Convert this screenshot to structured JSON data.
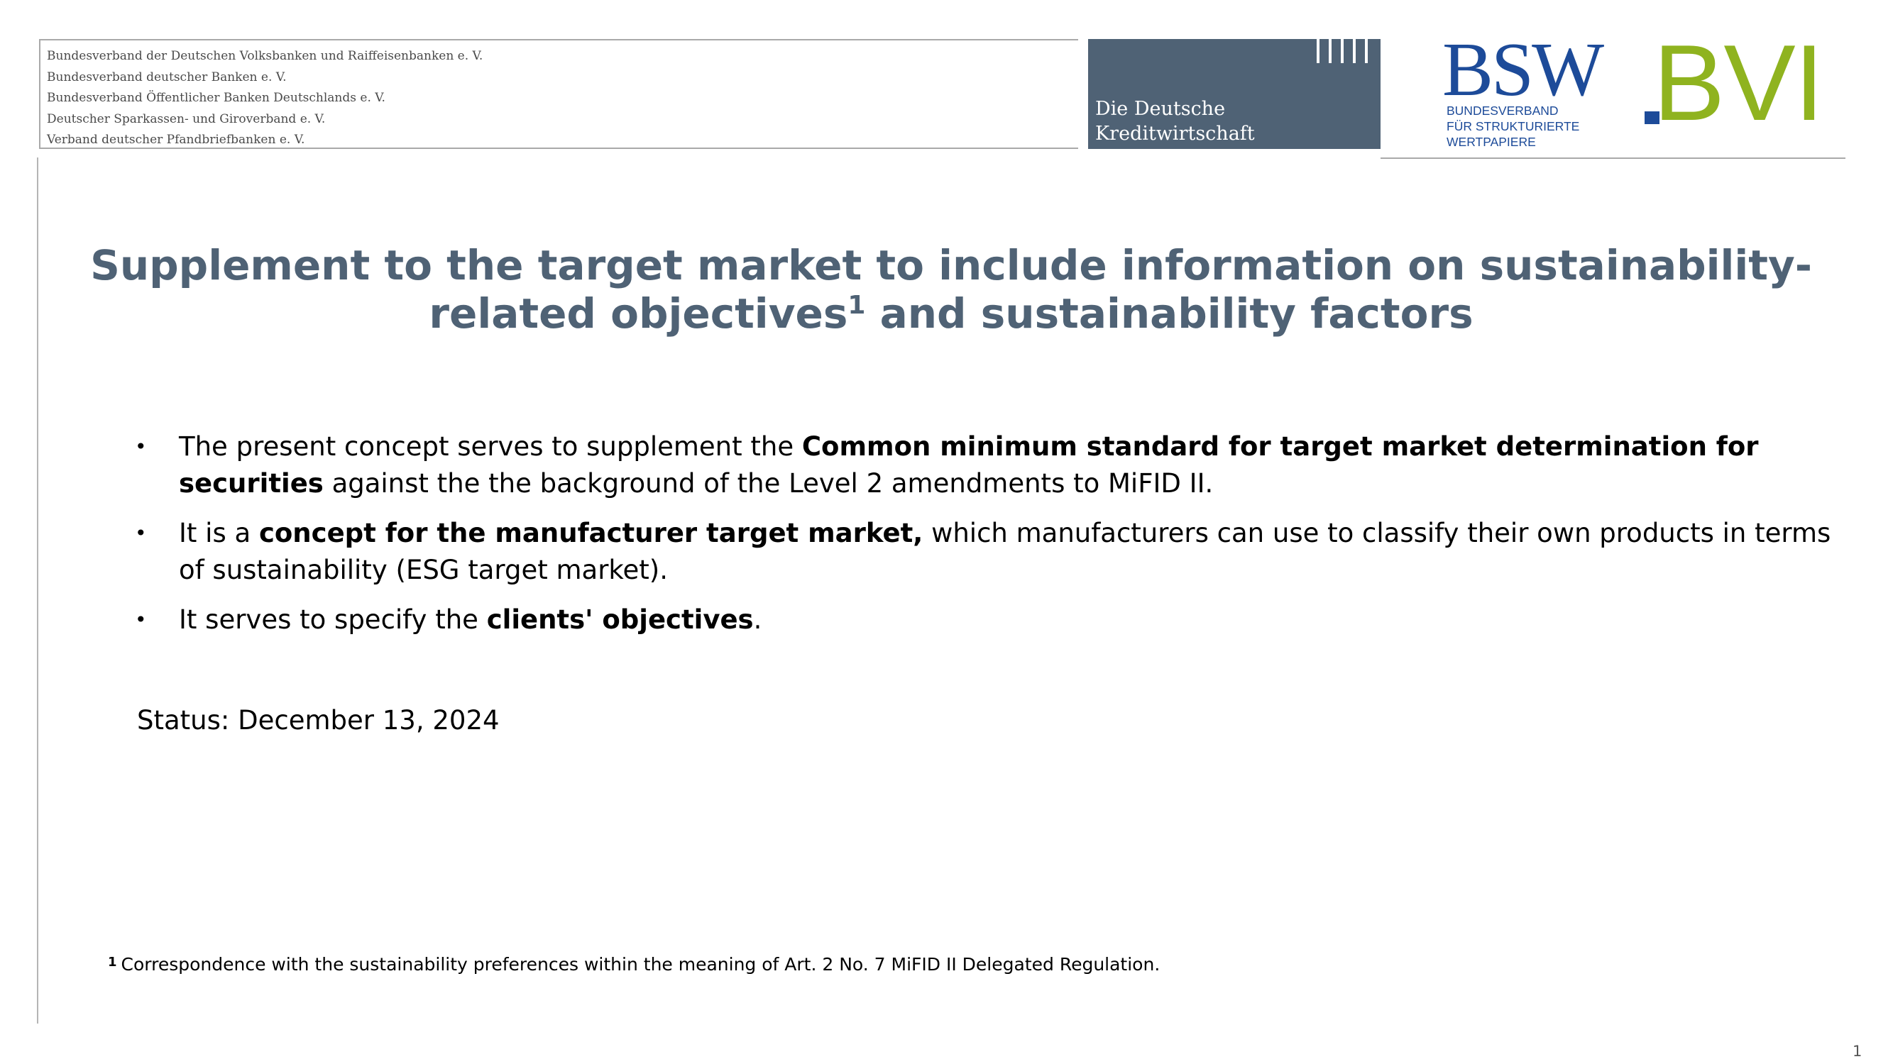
{
  "header": {
    "associations": [
      "Bundesverband der Deutschen Volksbanken und Raiffeisenbanken e. V.",
      "Bundesverband deutscher Banken e. V.",
      "Bundesverband Öffentlicher Banken Deutschlands e. V.",
      "Deutscher Sparkassen- und Giroverband e. V.",
      "Verband deutscher Pfandbriefbanken e. V."
    ],
    "ddk_logo": {
      "line1": "Die Deutsche",
      "line2": "Kreditwirtschaft",
      "color": "#4f6275"
    },
    "bsw_logo": {
      "wordmark": "BSW",
      "line1": "BUNDESVERBAND",
      "line2": "FÜR STRUKTURIERTE",
      "line3": "WERTPAPIERE",
      "color": "#1d4b99"
    },
    "bvi_logo": {
      "wordmark": "BVI",
      "color": "#8fb31f",
      "dot_color": "#1d4b99"
    }
  },
  "title": {
    "part1": "Supplement to the target market to include information on sustainability-related objectives",
    "sup": "1",
    "part2": " and sustainability factors",
    "color": "#4f6275"
  },
  "bullets": [
    {
      "symbol": "•",
      "pre": "The present concept serves to supplement the ",
      "bold": "Common minimum standard for target market determination for securities",
      "post": " against the the background of the Level 2 amendments to MiFID II."
    },
    {
      "symbol": "•",
      "pre": "It is a ",
      "bold": "concept for the manufacturer target market,",
      "post": " which manufacturers can use to classify their own products in terms of sustainability (ESG target market)."
    },
    {
      "symbol": "•",
      "pre": "It serves to specify the ",
      "bold": "clients' objectives",
      "post": "."
    }
  ],
  "status": "Status: December 13, 2024",
  "footnote": {
    "marker": "1",
    "text": "Correspondence with the sustainability preferences within the meaning of Art. 2 No. 7 MiFID II Delegated Regulation."
  },
  "page_number": "1"
}
